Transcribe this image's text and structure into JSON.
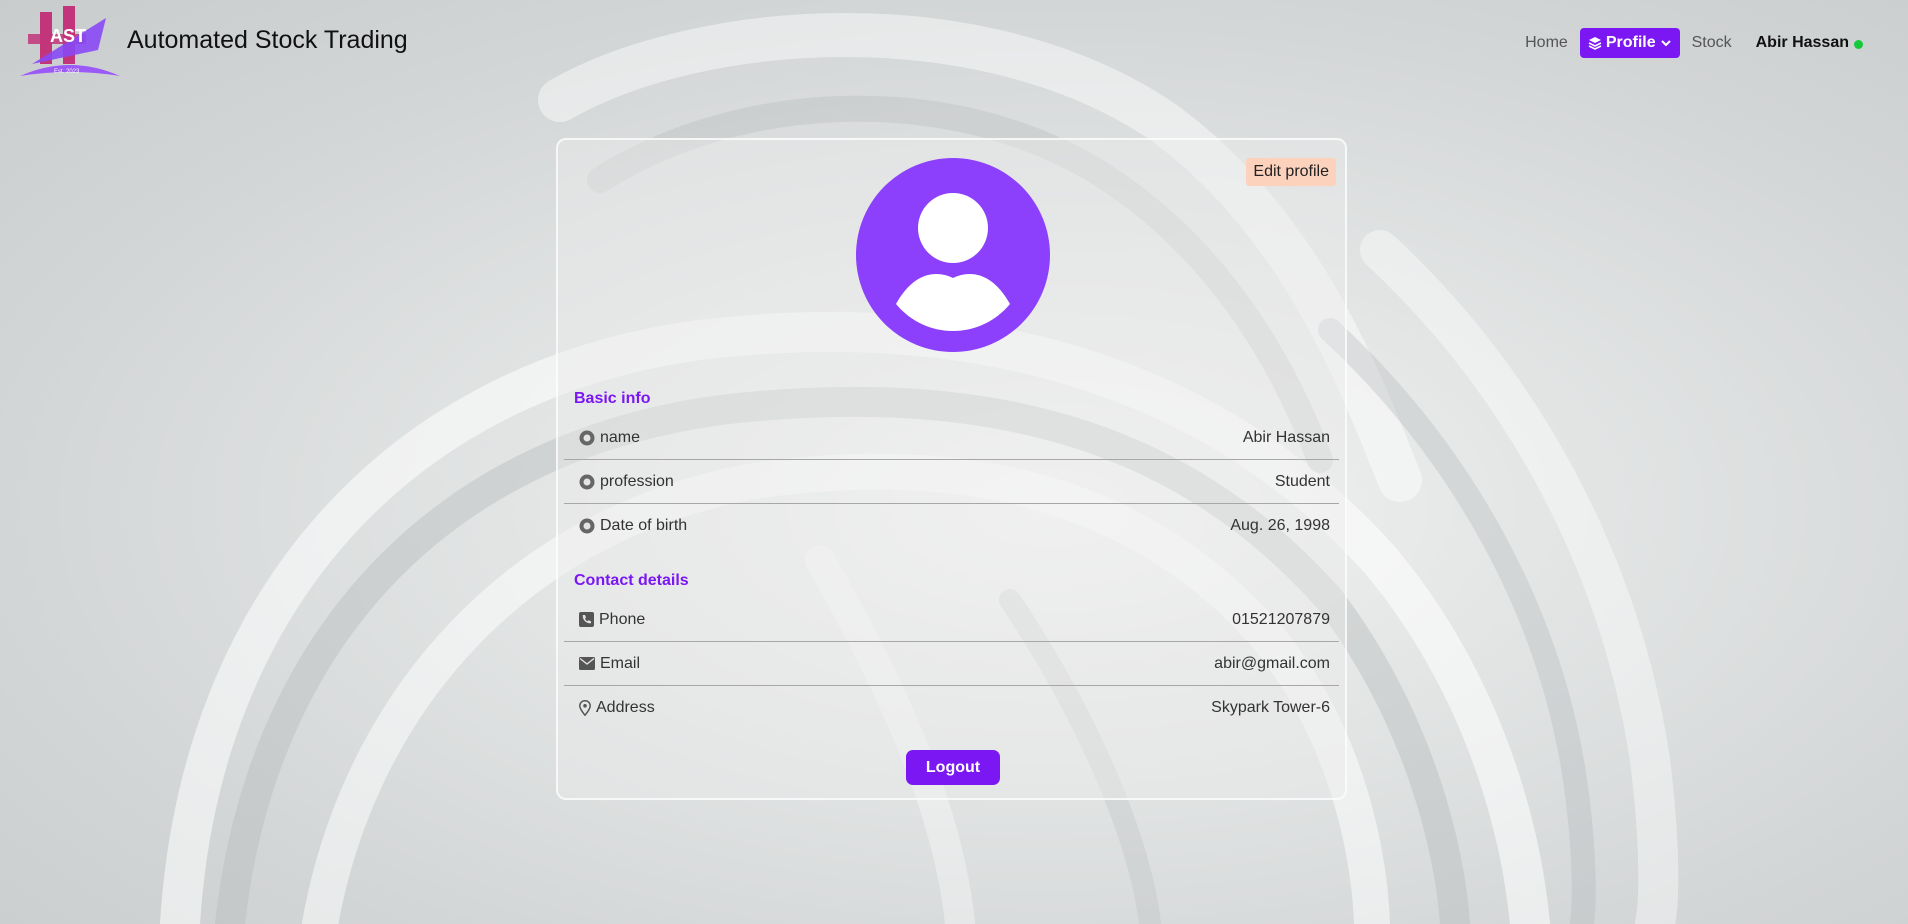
{
  "brand": {
    "logo_text": "AST",
    "logo_subtext": "Est. 2023",
    "title": "Automated Stock Trading"
  },
  "nav": {
    "home_label": "Home",
    "profile_label": "Profile",
    "stock_label": "Stock",
    "user_name": "Abir Hassan",
    "status_color": "#14c93a"
  },
  "profile": {
    "edit_label": "Edit profile",
    "basic_info_title": "Basic info",
    "basic_info": [
      {
        "label": "name",
        "value": "Abir Hassan",
        "icon": "dot-circle-icon"
      },
      {
        "label": "profession",
        "value": "Student",
        "icon": "dot-circle-icon"
      },
      {
        "label": "Date of birth",
        "value": "Aug. 26, 1998",
        "icon": "dot-circle-icon"
      }
    ],
    "contact_title": "Contact details",
    "contact": [
      {
        "label": "Phone",
        "value": "01521207879",
        "icon": "phone-icon"
      },
      {
        "label": "Email",
        "value": "abir@gmail.com",
        "icon": "envelope-icon"
      },
      {
        "label": "Address",
        "value": "Skypark Tower-6",
        "icon": "map-marker-icon"
      }
    ],
    "logout_label": "Logout"
  },
  "colors": {
    "accent": "#7a17f3",
    "avatar": "#8c40fb",
    "edit_button_bg": "#fdd2bd"
  }
}
